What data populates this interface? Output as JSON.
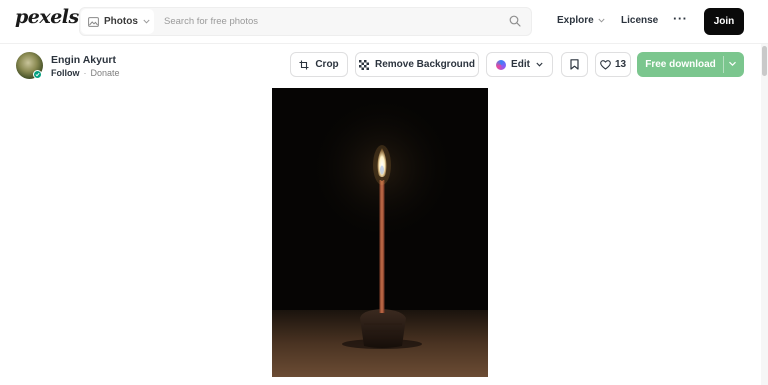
{
  "header": {
    "logo_text": "pexels",
    "search": {
      "type_label": "Photos",
      "placeholder": "Search for free photos",
      "value": ""
    },
    "nav": {
      "explore_label": "Explore",
      "license_label": "License",
      "more_label": "···",
      "join_label": "Join"
    }
  },
  "author": {
    "name": "Engin Akyurt",
    "follow_label": "Follow",
    "separator": "·",
    "donate_label": "Donate"
  },
  "actions": {
    "crop_label": "Crop",
    "remove_bg_label": "Remove Background",
    "edit_label": "Edit",
    "like_count": "13",
    "download_label": "Free download"
  },
  "icons": {
    "photo_type": "image-icon",
    "search": "search-icon",
    "crop": "crop-icon",
    "remove_bg": "checkerboard-icon",
    "bookmark": "bookmark-icon",
    "like": "heart-icon",
    "chevron": "chevron-down-icon"
  },
  "colors": {
    "accent_download": "#7bc68e",
    "join_button": "#0a0a0a",
    "verified_badge": "#05a081",
    "text_primary": "#2c343e"
  }
}
